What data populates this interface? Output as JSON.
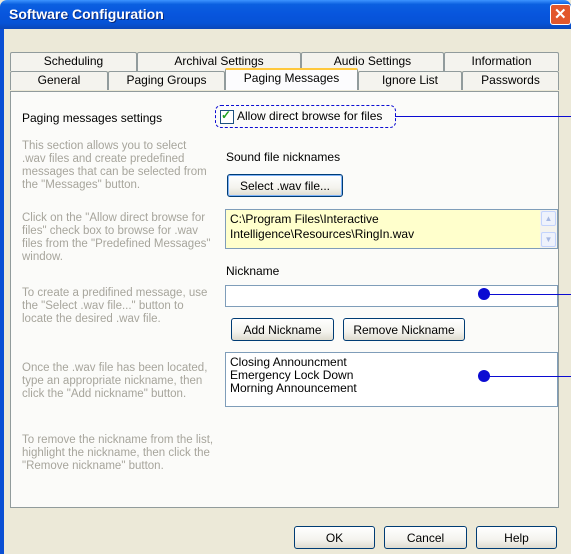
{
  "window": {
    "title": "Software Configuration"
  },
  "tabs_back": [
    "Scheduling",
    "Archival Settings",
    "Audio Settings",
    "Information"
  ],
  "tabs_front": [
    "General",
    "Paging Groups",
    "Paging Messages",
    "Ignore List",
    "Passwords"
  ],
  "active_tab": "Paging Messages",
  "section": {
    "title": "Paging messages settings",
    "help": [
      "This section allows you to select .wav files and create predefined messages that can be selected from the \"Messages\" button.",
      "Click on the \"Allow direct browse for files\" check box to browse for .wav files from the \"Predefined Messages\" window.",
      "To create a predifined message, use the \"Select .wav file...\" button to locate the desired .wav file.",
      "Once the .wav file has been located, type an appropriate nickname, then click the \"Add nickname\" button.",
      "To remove the nickname from the list, highlight the nickname, then click the \"Remove nickname\" button."
    ]
  },
  "allow_browse": {
    "label": "Allow direct browse for files",
    "checked": true
  },
  "sound_files": {
    "label": "Sound file nicknames",
    "select_button": "Select .wav file...",
    "path": "C:\\Program Files\\Interactive Intelligence\\Resources\\RingIn.wav"
  },
  "nickname": {
    "label": "Nickname",
    "value": ""
  },
  "buttons": {
    "add": "Add Nickname",
    "remove": "Remove Nickname"
  },
  "nickname_list": [
    "Closing Announcment",
    "Emergency Lock Down",
    "Morning Announcement"
  ],
  "dialog_buttons": {
    "ok": "OK",
    "cancel": "Cancel",
    "help": "Help"
  },
  "colors": {
    "titlebar": "#0855dd",
    "callout": "#0b0bd2",
    "path_background": "#ffffcc",
    "active_tab_accent": "#ffc83c"
  }
}
